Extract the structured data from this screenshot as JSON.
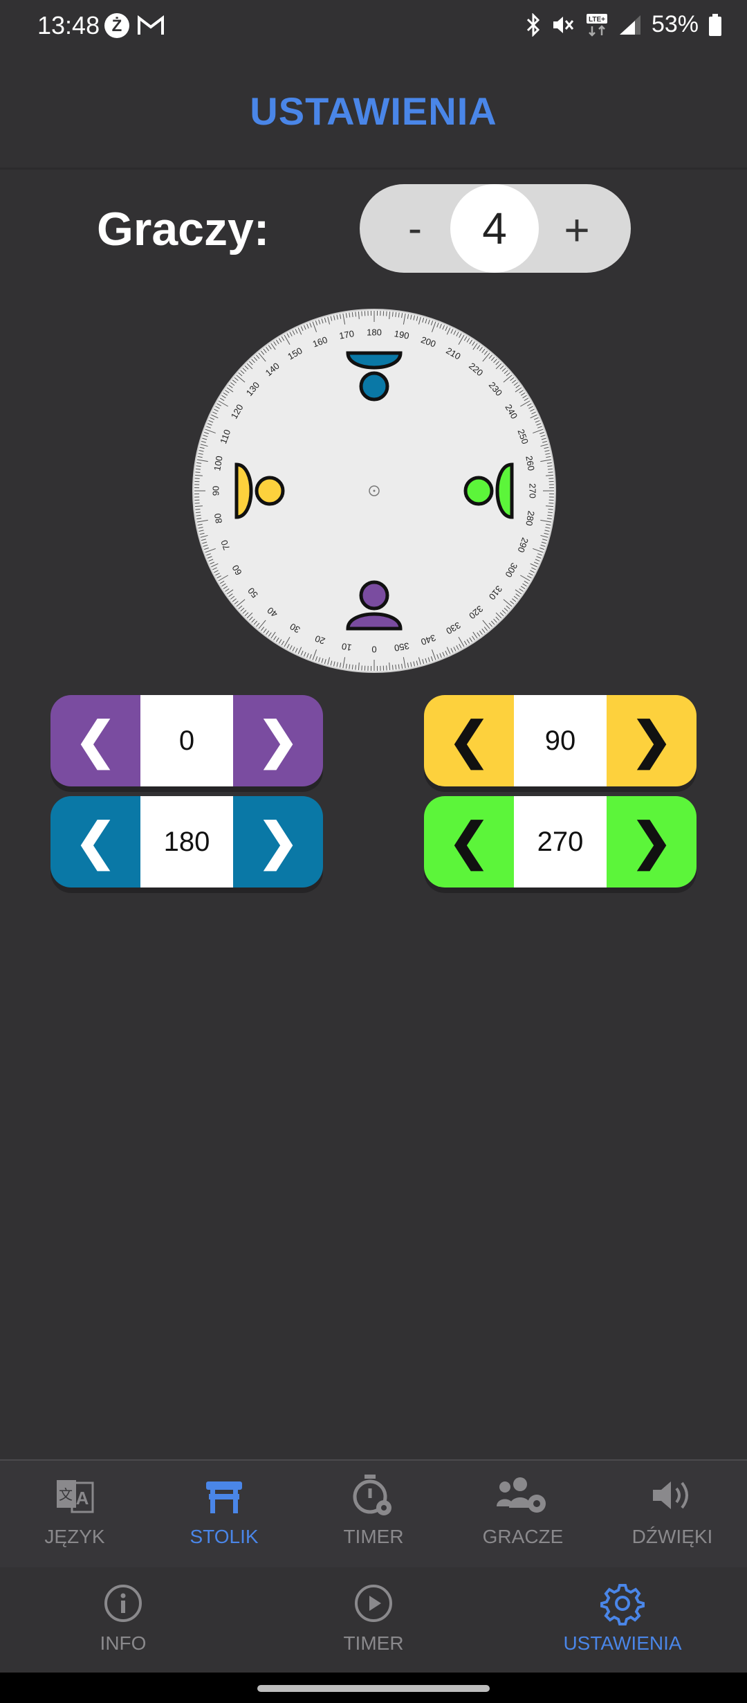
{
  "status_bar": {
    "time": "13:48",
    "battery": "53%",
    "icons": [
      "zabka-icon",
      "gmail-icon",
      "bluetooth-icon",
      "mute-icon",
      "lte-icon",
      "signal-icon",
      "battery-icon"
    ]
  },
  "header": {
    "title": "USTAWIENIA"
  },
  "players": {
    "label": "Graczy:",
    "minus": "-",
    "plus": "+",
    "count": "4"
  },
  "dial": {
    "colors": {
      "purple": "#7a4ca0",
      "blue": "#0a78a6",
      "yellow": "#fdd13d",
      "green": "#5cf53a"
    }
  },
  "controls": [
    {
      "color": "#7a4ca0",
      "value": "0",
      "left": "❮",
      "right": "❯"
    },
    {
      "color": "#0a78a6",
      "value": "180",
      "left": "❮",
      "right": "❯"
    },
    {
      "color": "#fdd13d",
      "value": "90",
      "left": "❮",
      "right": "❯"
    },
    {
      "color": "#5cf53a",
      "value": "270",
      "left": "❮",
      "right": "❯"
    }
  ],
  "top_nav": {
    "items": [
      {
        "label": "JĘZYK",
        "icon": "language-icon",
        "active": false
      },
      {
        "label": "STOLIK",
        "icon": "table-icon",
        "active": true
      },
      {
        "label": "TIMER",
        "icon": "timer-settings-icon",
        "active": false
      },
      {
        "label": "GRACZE",
        "icon": "players-settings-icon",
        "active": false
      },
      {
        "label": "DŹWIĘKI",
        "icon": "volume-icon",
        "active": false
      }
    ]
  },
  "bottom_nav": {
    "items": [
      {
        "label": "INFO",
        "icon": "info-icon",
        "active": false
      },
      {
        "label": "TIMER",
        "icon": "play-icon",
        "active": false
      },
      {
        "label": "USTAWIENIA",
        "icon": "gear-icon",
        "active": true
      }
    ]
  }
}
